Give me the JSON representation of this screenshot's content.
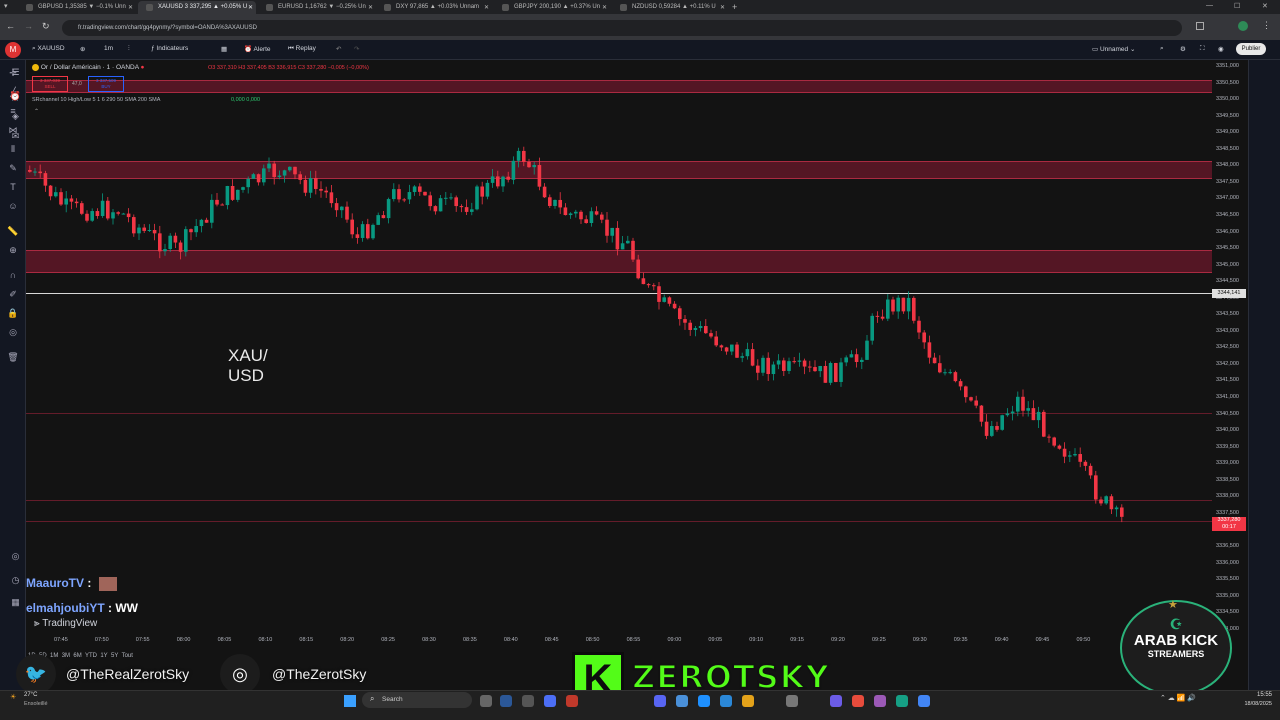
{
  "browser": {
    "tabs": [
      {
        "label": "GBPUSD 1,35385 ▼ −0.1% Unn"
      },
      {
        "label": "XAUUSD 3 337,295 ▲ +0.05% U"
      },
      {
        "label": "EURUSD 1,16762 ▼ −0.25% Un"
      },
      {
        "label": "DXY 97,865 ▲ +0.03% Unnam"
      },
      {
        "label": "GBPJPY 200,190 ▲ +0.37% Un"
      },
      {
        "label": "NZDUSD 0,59284 ▲ +0.11% U"
      }
    ],
    "url": "fr.tradingview.com/chart/gq4pynmy/?symbol=OANDA%3AXAUUSD"
  },
  "toolbar": {
    "symbol": "XAUUSD",
    "interval": "1m",
    "indicators": "Indicateurs",
    "alert": "Alerte",
    "replay": "Replay",
    "layout": "Unnamed",
    "publish": "Publier"
  },
  "legend": {
    "title": "Or / Dollar Américain · 1 · OANDA",
    "ohlc": "O3 337,310 H3 337,405 B3 336,915 C3 337,280 −0,005 (−0,00%)",
    "sell_price": "3 337,039",
    "sell_label": "SELL",
    "spread": "47,0",
    "buy_price": "3 337,509",
    "buy_label": "BUY",
    "indicator": "SRchannel 10 High/Low 5 1 6 290 50 SMA 200 SMA",
    "indicator_values": "0,000  0,000"
  },
  "watermark": "XAU/\nUSD",
  "price_axis": [
    "3351,000",
    "3350,500",
    "3350,000",
    "3349,500",
    "3349,000",
    "3348,500",
    "3348,000",
    "3347,500",
    "3347,000",
    "3346,500",
    "3346,000",
    "3345,500",
    "3345,000",
    "3344,500",
    "3344,000",
    "3343,500",
    "3343,000",
    "3342,500",
    "3342,000",
    "3341,500",
    "3341,000",
    "3340,500",
    "3340,000",
    "3339,500",
    "3339,000",
    "3338,500",
    "3338,000",
    "3337,500",
    "3337,000",
    "3336,500",
    "3336,000",
    "3335,500",
    "3335,000",
    "3334,500",
    "3334,000"
  ],
  "price_tags": {
    "hline": "3344,141",
    "current": "3337,280",
    "countdown": "00:17"
  },
  "time_axis": [
    "07:45",
    "07:50",
    "07:55",
    "08:00",
    "08:05",
    "08:10",
    "08:15",
    "08:20",
    "08:25",
    "08:30",
    "08:35",
    "08:40",
    "08:45",
    "08:50",
    "08:55",
    "09:00",
    "09:05",
    "09:10",
    "09:15",
    "09:20",
    "09:25",
    "09:30",
    "09:35",
    "09:40",
    "09:45",
    "09:50"
  ],
  "ranges": [
    "1D",
    "5D",
    "1M",
    "3M",
    "6M",
    "YTD",
    "1Y",
    "5Y",
    "Tout"
  ],
  "colors": {
    "up": "#089981",
    "down": "#f23645",
    "zone": "#d21e46",
    "kick_green": "#53fc18"
  },
  "stream": {
    "chat": [
      {
        "name": "MaauroTV",
        "sep": " : ",
        "msg": ""
      },
      {
        "name": "elmahjoubiYT",
        "sep": " : ",
        "msg": "WW"
      }
    ],
    "tv_logo": "TradingView",
    "twitter": "@TheRealZerotSky",
    "instagram": "@TheZerotSky",
    "kick_letter": "K",
    "brand": "ZEROTSKY",
    "badge_line1": "ARAB KICK",
    "badge_line2": "STREAMERS"
  },
  "taskbar": {
    "weather": "27°C",
    "weather_desc": "Ensoleillé",
    "search": "Search",
    "time": "15:55",
    "date": "18/08/2025"
  }
}
